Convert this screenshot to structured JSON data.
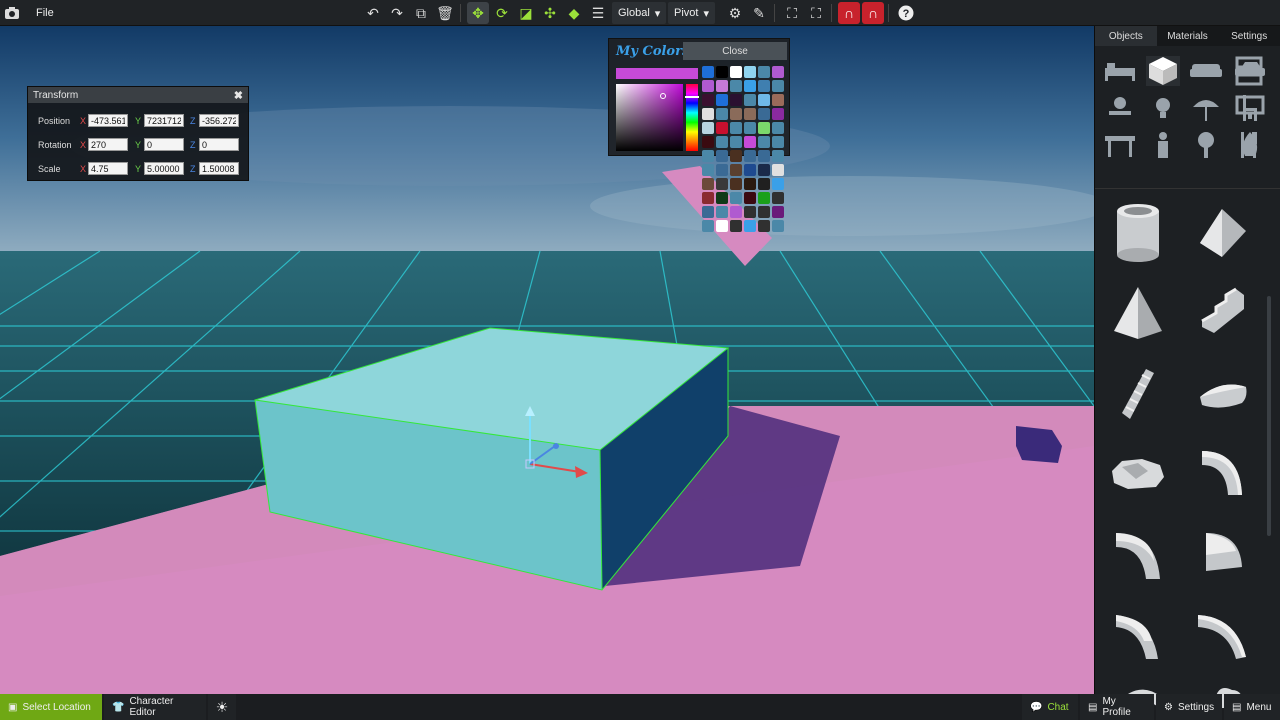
{
  "toolbar": {
    "file_label": "File",
    "space_mode": "Global",
    "pivot_mode": "Pivot"
  },
  "transform": {
    "title": "Transform",
    "axis_labels": {
      "x": "X",
      "y": "Y",
      "z": "Z"
    },
    "rows": [
      {
        "label": "Position",
        "x": "-473.561",
        "y": "7231712",
        "z": "-356.272"
      },
      {
        "label": "Rotation",
        "x": "270",
        "y": "0",
        "z": "0"
      },
      {
        "label": "Scale",
        "x": "4.75",
        "y": "5.00000",
        "z": "1.50008"
      }
    ]
  },
  "colors": {
    "title": "My Colors",
    "close_label": "Close",
    "current": "#c64ad8",
    "swatches": [
      "#1e6fd9",
      "#000000",
      "#ffffff",
      "#8fd3ef",
      "#4b88a8",
      "#b05ad0",
      "#b05ad0",
      "#c67ad8",
      "#4b88a8",
      "#3aa0e8",
      "#3f7fb0",
      "#4b88a8",
      "#3a1030",
      "#1e6fd9",
      "#2a1030",
      "#4b88a8",
      "#6fb8e8",
      "#9b6b5a",
      "#e0e0e0",
      "#4b88a8",
      "#8a6b5a",
      "#8a6b5a",
      "#3a6a95",
      "#8a2aa0",
      "#b8d4e0",
      "#c8102e",
      "#4b88a8",
      "#4b88a8",
      "#7bd86b",
      "#4b88a8",
      "#3a0a10",
      "#4b88a8",
      "#4b88a8",
      "#c64ad8",
      "#4b88a8",
      "#4b88a8",
      "#4b88a8",
      "#3a6a95",
      "#4a3020",
      "#3a6a95",
      "#3a6a95",
      "#4b88a8",
      "#4b88a8",
      "#3a6a95",
      "#5a4030",
      "#1e4a90",
      "#1a2a4a",
      "#e0e0e0",
      "#6b4a3a",
      "#3a3a3a",
      "#4a3020",
      "#2a1a10",
      "#202020",
      "#3aa0e8",
      "#8a2a30",
      "#103a18",
      "#4b88a8",
      "#3a0a10",
      "#1aa01a",
      "#303030",
      "#3a6a95",
      "#4b88a8",
      "#b05ad0",
      "#303030",
      "#303030",
      "#6a1a7a",
      "#4b88a8",
      "#ffffff",
      "#303030",
      "#3aa0e8",
      "#303030",
      "#4b88a8"
    ]
  },
  "right_panel": {
    "tabs": [
      "Objects",
      "Materials",
      "Settings"
    ],
    "active_tab": "Objects"
  },
  "bottom": {
    "select_location": "Select Location",
    "character_editor": "Character Editor",
    "chat": "Chat",
    "my_profile": "My Profile",
    "settings": "Settings",
    "menu": "Menu"
  }
}
